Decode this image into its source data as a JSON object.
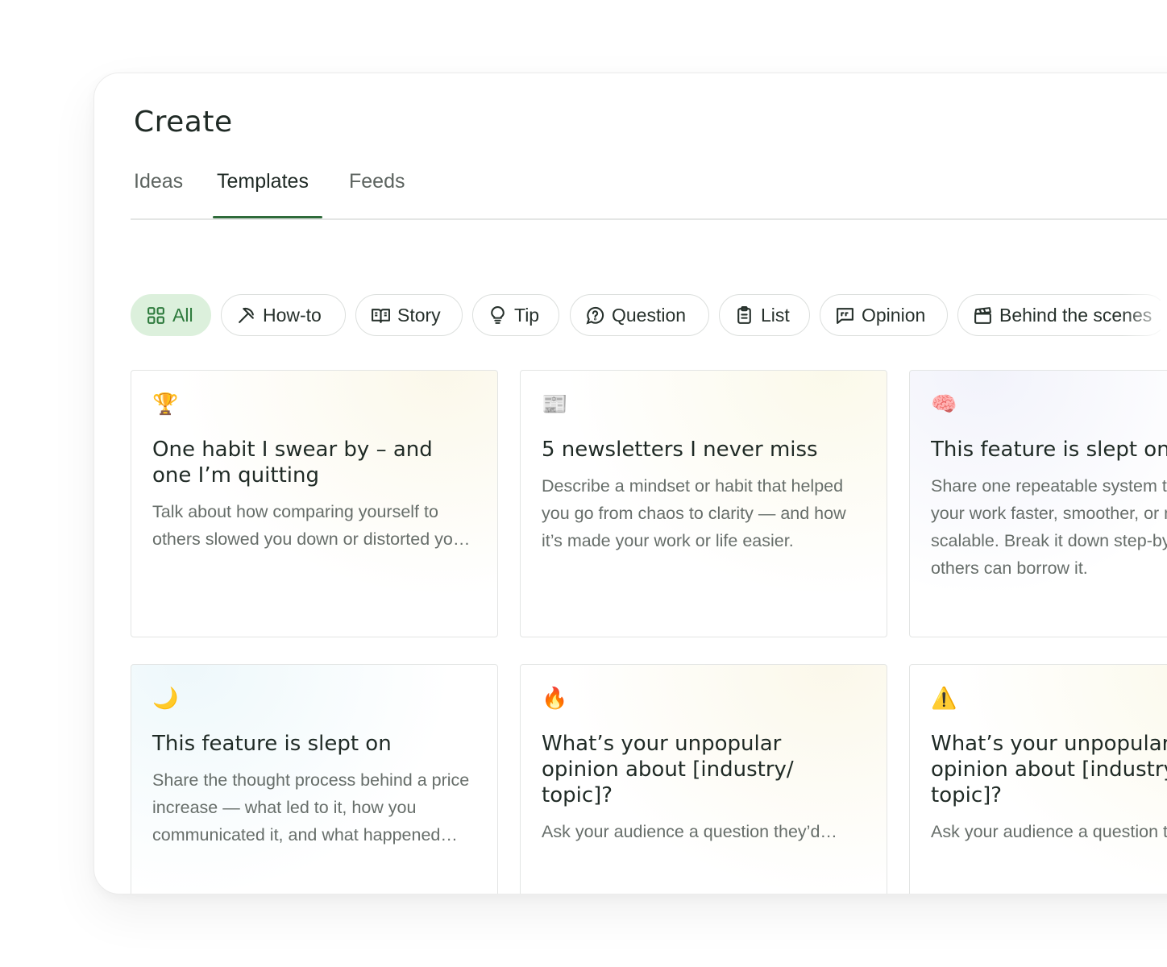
{
  "page": {
    "title": "Create"
  },
  "tabs": [
    {
      "label": "Ideas"
    },
    {
      "label": "Templates",
      "active": true
    },
    {
      "label": "Feeds"
    }
  ],
  "filters": [
    {
      "label": "All",
      "icon": "grid-icon",
      "active": true
    },
    {
      "label": "How-to",
      "icon": "pickaxe-icon"
    },
    {
      "label": "Story",
      "icon": "book-open-icon"
    },
    {
      "label": "Tip",
      "icon": "lightbulb-icon"
    },
    {
      "label": "Question",
      "icon": "question-bubble-icon"
    },
    {
      "label": "List",
      "icon": "clipboard-list-icon"
    },
    {
      "label": "Opinion",
      "icon": "quote-bubble-icon"
    },
    {
      "label": "Behind the scenes",
      "icon": "clapperboard-icon"
    }
  ],
  "cards": [
    {
      "emoji": "🏆",
      "icon": "trophy-icon",
      "title": "One habit I swear by – and\none I’m quitting",
      "description": "Talk about how comparing yourself to others slowed you down or distorted your sense of progress."
    },
    {
      "emoji": "📰",
      "icon": "newspaper-icon",
      "title": "5 newsletters I never miss",
      "description": "Describe a mindset or habit that helped you go from chaos to clarity — and how it’s made your work or life easier."
    },
    {
      "emoji": "🧠",
      "icon": "brain-icon",
      "title": "This feature is slept on",
      "description": "Share one repeatable system that makes your work faster, smoother, or more scalable. Break it down step-by-step so others can borrow it."
    },
    {
      "emoji": "🌙",
      "icon": "moon-icon",
      "title": "This feature is slept on",
      "description": "Share the thought process behind a price increase — what led to it, how you communicated it, and what happened next."
    },
    {
      "emoji": "🔥",
      "icon": "fire-icon",
      "title": "What’s your unpopular\nopinion about [industry/\ntopic]?",
      "description": "Ask your audience a question they’d enjoy answering."
    },
    {
      "emoji": "⚠️",
      "icon": "warning-icon",
      "title": "What’s your unpopular\nopinion about [industry/\ntopic]?",
      "description": "Ask your audience a question they’d enjoy answering."
    }
  ],
  "colors": {
    "accent": "#2f6b3a",
    "chip_active_bg": "#dcf0dc",
    "chip_active_text": "#2d7a3c"
  }
}
